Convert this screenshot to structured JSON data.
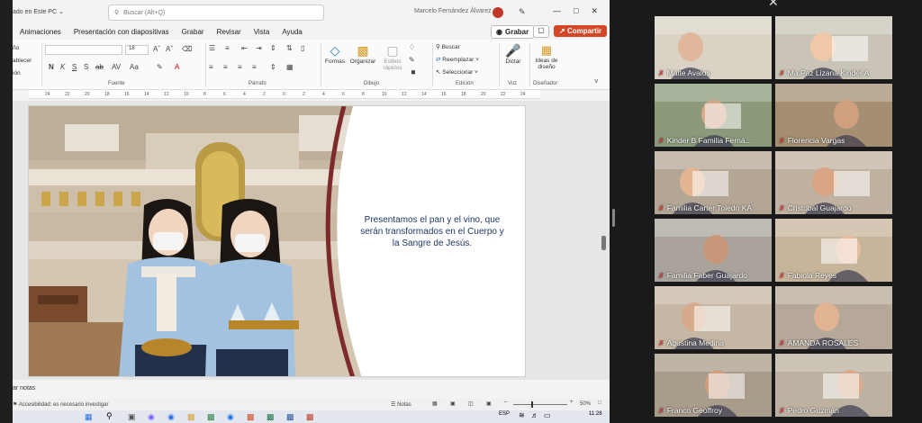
{
  "titlebar": {
    "title_fragment": "ado en Este PC ⌄",
    "search_placeholder": "Buscar (Alt+Q)",
    "user_name": "Marcelo Fernández Álvarez"
  },
  "menubar": {
    "tabs": [
      "Animaciones",
      "Presentación con diapositivas",
      "Grabar",
      "Revisar",
      "Vista",
      "Ayuda"
    ],
    "grabar_button": "Grabar",
    "share_button": "Compartir"
  },
  "ribbon": {
    "left_fragments": [
      "ño",
      "ablecer",
      "ión"
    ],
    "groups": {
      "fuente": "Fuente",
      "parrafo": "Párrafo",
      "dibujo": "Dibujo",
      "edicion": "Edición",
      "voz": "Voz",
      "disenador": "Diseñador"
    },
    "buttons": {
      "formas": "Formas",
      "organizar": "Organizar",
      "estilos": "Estilos rápidos",
      "buscar": "Buscar",
      "reemplazar": "Reemplazar",
      "seleccionar": "Seleccionar",
      "dictar": "Dictar",
      "ideas": "Ideas de diseño"
    },
    "font_size": "18"
  },
  "ruler": {
    "ticks": [
      "24",
      "22",
      "20",
      "18",
      "16",
      "14",
      "12",
      "10",
      "8",
      "6",
      "4",
      "2",
      "0",
      "2",
      "4",
      "6",
      "8",
      "10",
      "12",
      "14",
      "16",
      "18",
      "20",
      "22",
      "24"
    ]
  },
  "slide": {
    "text": "Presentamos el pan y el vino, que serán transformados en el Cuerpo y la Sangre de Jesús."
  },
  "notes": {
    "label": "ar notas"
  },
  "statusbar": {
    "accessibility": "Accesibilidad: es necesario investigar",
    "notes_button": "Notas",
    "zoom": "50%"
  },
  "taskbar": {
    "lang": "ESP",
    "time": "11:28"
  },
  "participants": [
    {
      "name": "Maite Avalos"
    },
    {
      "name": "Ma.Paz Lizana Kinder A"
    },
    {
      "name": "Kinder B Familia Ferná..."
    },
    {
      "name": "Florencia Vargas"
    },
    {
      "name": "Familia Carter Toledo KA"
    },
    {
      "name": "Cristobal Guajardo"
    },
    {
      "name": "Familia Faber Guajardo"
    },
    {
      "name": "Fabiola Reyes"
    },
    {
      "name": "Agustina Medina"
    },
    {
      "name": "AMANDA ROSALES"
    },
    {
      "name": "Franco Geoffroy"
    },
    {
      "name": "Pedro Guzmán"
    }
  ],
  "colors": {
    "accent": "#d24726",
    "slide_text": "#1f3864",
    "mic_muted": "#e23a3a"
  }
}
